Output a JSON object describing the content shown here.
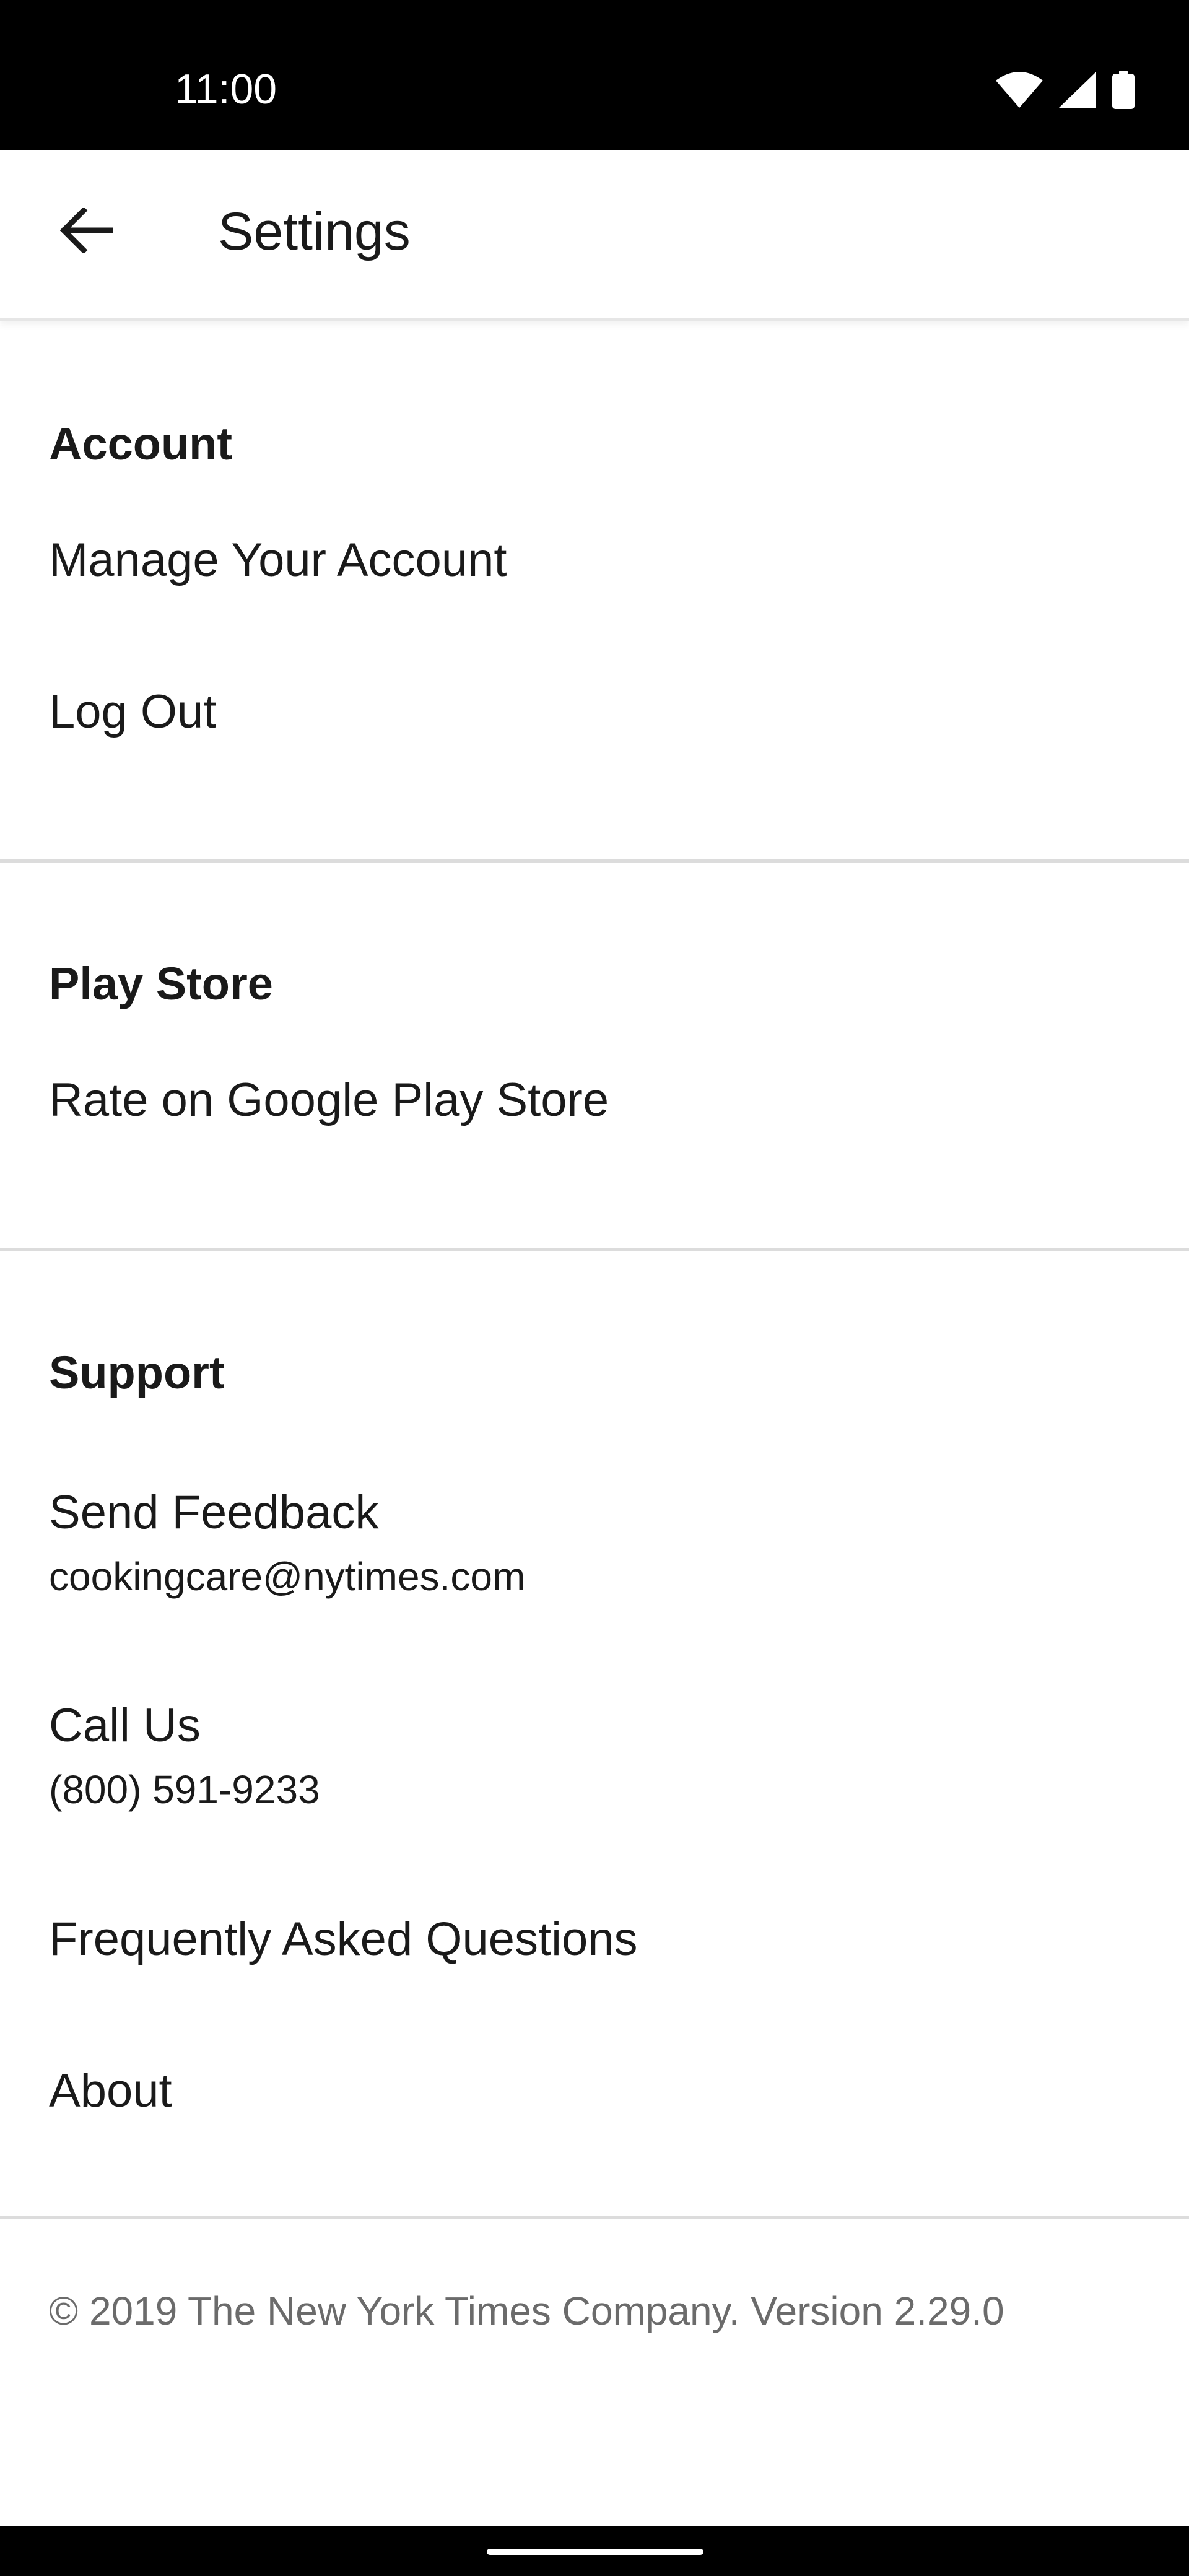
{
  "status_bar": {
    "time": "11:00",
    "icons": [
      "wifi-icon",
      "cellular-signal-icon",
      "battery-icon"
    ]
  },
  "app_bar": {
    "back_icon": "arrow-left-icon",
    "title": "Settings"
  },
  "sections": [
    {
      "heading": "Account",
      "items": [
        {
          "label": "Manage Your Account"
        },
        {
          "label": "Log Out"
        }
      ]
    },
    {
      "heading": "Play Store",
      "items": [
        {
          "label": "Rate on Google Play Store"
        }
      ]
    },
    {
      "heading": "Support",
      "items": [
        {
          "label": "Send Feedback",
          "sublabel": "cookingcare@nytimes.com"
        },
        {
          "label": "Call Us",
          "sublabel": "(800) 591-9233"
        },
        {
          "label": "Frequently Asked Questions"
        },
        {
          "label": "About"
        }
      ]
    }
  ],
  "footer": {
    "text": "© 2019 The New York Times Company. Version 2.29.0"
  },
  "colors": {
    "background": "#ffffff",
    "text": "#1a1a1a",
    "muted_text": "#6b6b6b",
    "divider": "#dcdcdc",
    "system_bars": "#000000"
  }
}
